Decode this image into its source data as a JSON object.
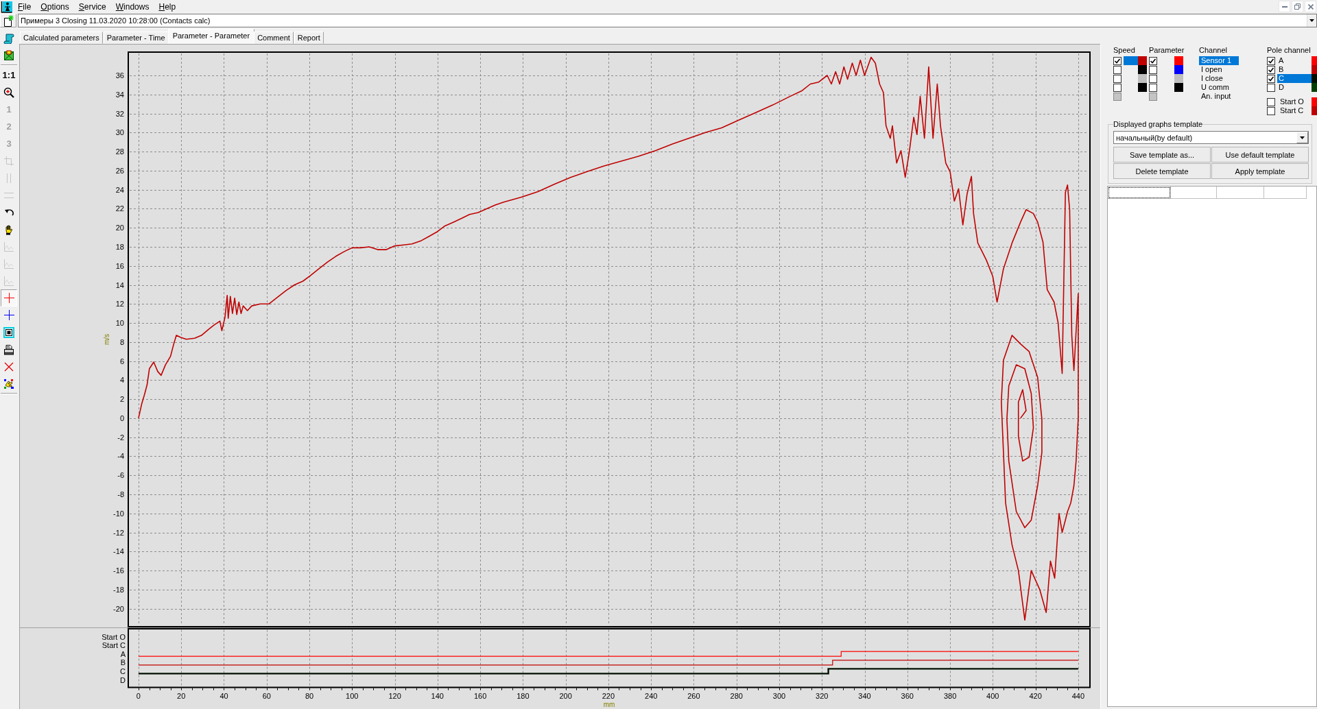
{
  "menu": [
    "File",
    "Options",
    "Service",
    "Windows",
    "Help"
  ],
  "document_selector": {
    "value": "Примеры 3 Closing 11.03.2020 10:28:00 (Contacts calc)"
  },
  "toolbar_groups": [
    {
      "items": [
        {
          "kind": "scroll",
          "disabled": false,
          "pressed": false
        },
        {
          "kind": "map",
          "disabled": false,
          "pressed": false
        }
      ]
    },
    {
      "items": [
        {
          "kind": "text",
          "label": "1:1",
          "disabled": false,
          "pressed": false
        },
        {
          "kind": "zoom",
          "disabled": false,
          "pressed": false
        },
        {
          "kind": "text",
          "label": "1",
          "disabled": true,
          "pressed": false
        },
        {
          "kind": "text",
          "label": "2",
          "disabled": true,
          "pressed": false
        },
        {
          "kind": "text",
          "label": "3",
          "disabled": true,
          "pressed": false
        },
        {
          "kind": "crop",
          "disabled": true,
          "pressed": false
        },
        {
          "kind": "columns",
          "disabled": true,
          "pressed": false
        },
        {
          "kind": "rows",
          "disabled": true,
          "pressed": false
        },
        {
          "kind": "undo",
          "disabled": false,
          "pressed": false
        },
        {
          "kind": "hand",
          "disabled": false,
          "pressed": false
        },
        {
          "kind": "chart",
          "disabled": true,
          "pressed": false
        },
        {
          "kind": "chart",
          "disabled": true,
          "pressed": false
        },
        {
          "kind": "chart",
          "disabled": true,
          "pressed": false
        },
        {
          "kind": "crosshair",
          "color": "#ff0000",
          "disabled": false,
          "pressed": true
        },
        {
          "kind": "crosshair",
          "color": "#0000ff",
          "disabled": false,
          "pressed": false
        },
        {
          "kind": "frame",
          "disabled": false,
          "pressed": false
        },
        {
          "kind": "printer",
          "disabled": false,
          "pressed": false
        },
        {
          "kind": "delete",
          "disabled": false,
          "pressed": false
        },
        {
          "kind": "palette",
          "disabled": false,
          "pressed": false
        }
      ]
    }
  ],
  "tabs": [
    {
      "label": "Calculated parameters",
      "selected": false
    },
    {
      "label": "Parameter - Time",
      "selected": false
    },
    {
      "label": "Parameter - Parameter",
      "selected": true
    },
    {
      "label": "Comment",
      "selected": false
    },
    {
      "label": "Report",
      "selected": false
    }
  ],
  "plot": {
    "chart_data": {
      "type": "line",
      "xlabel": "mm",
      "ylabel": "m/s",
      "grid": true,
      "xlim": [
        -4.8,
        445.5
      ],
      "ylim": [
        -21.9,
        38.45
      ],
      "xticks": [
        0,
        20,
        40,
        60,
        80,
        100,
        120,
        140,
        160,
        180,
        200,
        220,
        240,
        260,
        280,
        300,
        320,
        340,
        360,
        380,
        400,
        420,
        440
      ],
      "yticks": [
        36,
        34,
        32,
        30,
        28,
        26,
        24,
        22,
        20,
        18,
        16,
        14,
        12,
        10,
        8,
        6,
        4,
        2,
        0,
        -2,
        -4,
        -6,
        -8,
        -10,
        -12,
        -14,
        -16,
        -18,
        -20
      ],
      "x": [
        0,
        1.5,
        2.8,
        4,
        5.1,
        7.1,
        9,
        10.6,
        12.6,
        15,
        16.5,
        17.7,
        19.7,
        22.4,
        26.3,
        29.5,
        32.6,
        35.4,
        38.1,
        39,
        40.5,
        41.5,
        42,
        43,
        44,
        45,
        46,
        47,
        48,
        49,
        51,
        53,
        57,
        61,
        65,
        69,
        73,
        77,
        80.6,
        84.5,
        88.5,
        92.4,
        96.3,
        100,
        104,
        108,
        112,
        116,
        120,
        124,
        128,
        132,
        136,
        140,
        143.5,
        147.5,
        151.4,
        155,
        159,
        163,
        167,
        171,
        179,
        187,
        195,
        202.5,
        210,
        218,
        226,
        234,
        242,
        250,
        257.6,
        265.4,
        273,
        281,
        289,
        297,
        305,
        310.7,
        314.6,
        318.5,
        322.5,
        324.4,
        326.4,
        328.3,
        330.3,
        332,
        334.2,
        336,
        338,
        340,
        343,
        345,
        347,
        348.8,
        350,
        352,
        353,
        355,
        357,
        359,
        361,
        363,
        364.5,
        366,
        368,
        370,
        372,
        374,
        375.5,
        378,
        380,
        382,
        384,
        386,
        388,
        390,
        391,
        393,
        397,
        400,
        402,
        405,
        409,
        413,
        415.6,
        419,
        421,
        423.5,
        425.5,
        428.7,
        430.6,
        432.5,
        434,
        435,
        436,
        437,
        438,
        440,
        440,
        439,
        438,
        436.5,
        435,
        434,
        432.5,
        431,
        429,
        427,
        425,
        422,
        418,
        415,
        412,
        409,
        406,
        405,
        404,
        405,
        409,
        413,
        417,
        421,
        423,
        423,
        421,
        418,
        415,
        411,
        407.5,
        406.6,
        407.5,
        411,
        415,
        418,
        419,
        417,
        414,
        412,
        412,
        414,
        415.6,
        413
      ],
      "series": [
        {
          "color": "#c00000",
          "values": [
            0,
            1.5,
            2.5,
            3.5,
            5.2,
            5.9,
            4.9,
            4.5,
            5.6,
            6.5,
            7.8,
            8.7,
            8.5,
            8.3,
            8.4,
            8.7,
            9.3,
            9.8,
            10.2,
            9.2,
            10.6,
            12.9,
            10.5,
            12.8,
            11,
            12.6,
            10.9,
            12.2,
            11.0,
            11.8,
            11.3,
            11.8,
            12.0,
            12.0,
            12.7,
            13.4,
            14.0,
            14.4,
            15.0,
            15.7,
            16.4,
            17.0,
            17.5,
            17.9,
            17.9,
            18.0,
            17.7,
            17.7,
            18.1,
            18.2,
            18.3,
            18.6,
            19.1,
            19.6,
            20.2,
            20.6,
            21.0,
            21.4,
            21.6,
            22.0,
            22.4,
            22.7,
            23.2,
            23.8,
            24.6,
            25.3,
            25.9,
            26.5,
            27.0,
            27.5,
            28.1,
            28.8,
            29.4,
            30.0,
            30.5,
            31.3,
            32.1,
            32.9,
            33.8,
            34.4,
            35.1,
            35.3,
            36.0,
            35.1,
            36.4,
            35.1,
            36.9,
            35.6,
            37.3,
            36,
            37.6,
            36,
            37.9,
            37.3,
            35.1,
            34.2,
            30.7,
            29.4,
            30.7,
            26.8,
            28.1,
            25.3,
            28.1,
            31.6,
            29.8,
            33.8,
            29.4,
            36.9,
            29.4,
            35.1,
            30.7,
            26.8,
            25.9,
            22.8,
            24.1,
            20.3,
            23.6,
            25.4,
            21.5,
            18.4,
            16.6,
            14.9,
            12.2,
            15.7,
            18.4,
            20.6,
            21.9,
            21.5,
            20.6,
            18.5,
            13.5,
            12.2,
            10.0,
            4.7,
            23.7,
            24.5,
            21.9,
            8.7,
            5,
            13.1,
            0,
            -4.5,
            -7.1,
            -8.9,
            -9.8,
            -10.7,
            -12,
            -10,
            -16.8,
            -15,
            -20.4,
            -18,
            -16,
            -21.2,
            -16,
            -13.3,
            -8.9,
            -3.6,
            1.7,
            6.1,
            8.7,
            7.8,
            7.0,
            4.3,
            -0.1,
            -3.6,
            -7.1,
            -10.7,
            -11.5,
            -9.8,
            -4.5,
            -0.1,
            3.4,
            5.6,
            5.2,
            2.6,
            -1.0,
            -4.1,
            -4.5,
            -1.9,
            1.7,
            3.0,
            0.8,
            0
          ]
        }
      ]
    }
  },
  "signal_plot": {
    "lanes": [
      "Start O",
      "Start C",
      "A",
      "B",
      "C",
      "D"
    ]
  },
  "channel_headers": {
    "speed": "Speed",
    "parameter": "Parameter",
    "channel": "Channel",
    "pole_channel": "Pole channel"
  },
  "channels": [
    {
      "name": "Sensor 1",
      "selected": true,
      "speed": {
        "checked": true,
        "disabled": false,
        "color": "#c00000"
      },
      "parameter": {
        "checked": true,
        "disabled": false,
        "color": "#ff0000"
      }
    },
    {
      "name": "I open",
      "selected": false,
      "speed": {
        "checked": false,
        "disabled": false,
        "color": "#000000"
      },
      "parameter": {
        "checked": false,
        "disabled": false,
        "color": "#0000ff"
      }
    },
    {
      "name": "I close",
      "selected": false,
      "speed": {
        "checked": false,
        "disabled": false,
        "color": "#c0c0c0"
      },
      "parameter": {
        "checked": false,
        "disabled": false,
        "color": "#c0c0c0"
      }
    },
    {
      "name": "U comm",
      "selected": false,
      "speed": {
        "checked": false,
        "disabled": false,
        "color": "#000000"
      },
      "parameter": {
        "checked": false,
        "disabled": false,
        "color": "#000000"
      }
    },
    {
      "name": "An. input",
      "selected": false,
      "speed": {
        "checked": false,
        "disabled": true
      },
      "parameter": {
        "checked": false,
        "disabled": true
      }
    }
  ],
  "pole_channels": [
    {
      "name": "A",
      "checked": true,
      "selected": false,
      "color": "#ff0000"
    },
    {
      "name": "B",
      "checked": true,
      "selected": false,
      "color": "#c00000"
    },
    {
      "name": "C",
      "checked": true,
      "selected": true,
      "color": "#001000"
    },
    {
      "name": "D",
      "checked": false,
      "selected": false,
      "color": "#004000"
    }
  ],
  "start_signals": [
    {
      "name": "Start O",
      "checked": false,
      "color": "#ff0000"
    },
    {
      "name": "Start C",
      "checked": false,
      "color": "#c00000"
    }
  ],
  "template_group": {
    "title": "Displayed graphs template",
    "template": {
      "value": "начальный(by default)"
    },
    "buttons": [
      "Save template as...",
      "Use default template",
      "Delete template",
      "Apply template"
    ]
  },
  "results_table": {
    "header_cells": [
      {
        "focused": true
      },
      {
        "focused": false
      },
      {
        "focused": false
      },
      {
        "focused": false
      }
    ]
  }
}
